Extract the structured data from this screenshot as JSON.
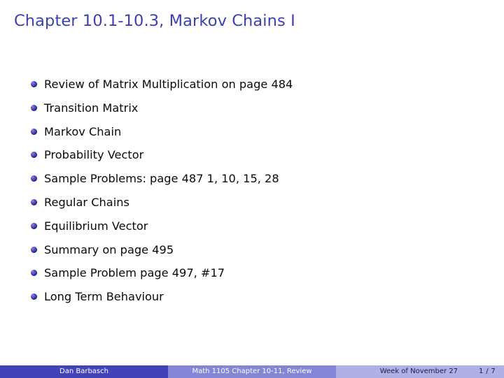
{
  "slide": {
    "title": "Chapter 10.1-10.3, Markov Chains I",
    "bullet_icon": "sphere-bullet-icon",
    "items": [
      {
        "label": "Review of Matrix Multiplication on page 484"
      },
      {
        "label": "Transition Matrix"
      },
      {
        "label": "Markov Chain"
      },
      {
        "label": "Probability Vector"
      },
      {
        "label": "Sample Problems:  page 487 1, 10, 15, 28"
      },
      {
        "label": "Regular Chains"
      },
      {
        "label": "Equilibrium Vector"
      },
      {
        "label": "Summary on page 495"
      },
      {
        "label": "Sample Problem page 497, #17"
      },
      {
        "label": "Long Term Behaviour"
      }
    ]
  },
  "footer": {
    "author": "Dan Barbasch",
    "course": "Math 1105 Chapter 10-11, Review",
    "date": "Week of November 27",
    "page": "1 / 7"
  },
  "colors": {
    "title_blue": "#3f3fb3",
    "footer_dark": "#4343b8",
    "footer_mid": "#8585d6",
    "footer_light": "#b0b0e4",
    "body_text": "#0a0a0a",
    "background": "#ffffff"
  }
}
